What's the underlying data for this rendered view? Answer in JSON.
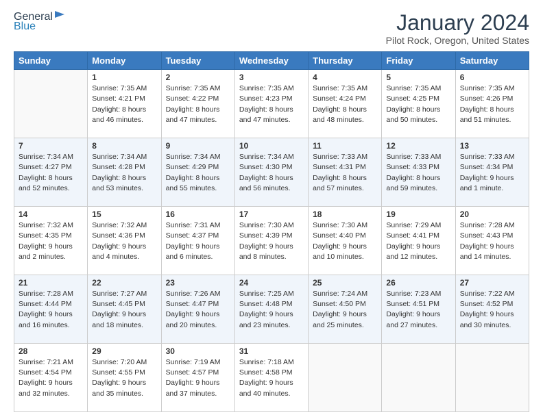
{
  "header": {
    "logo_general": "General",
    "logo_blue": "Blue",
    "main_title": "January 2024",
    "subtitle": "Pilot Rock, Oregon, United States"
  },
  "days_of_week": [
    "Sunday",
    "Monday",
    "Tuesday",
    "Wednesday",
    "Thursday",
    "Friday",
    "Saturday"
  ],
  "weeks": [
    [
      {
        "day": "",
        "sunrise": "",
        "sunset": "",
        "daylight": "",
        "empty": true
      },
      {
        "day": "1",
        "sunrise": "Sunrise: 7:35 AM",
        "sunset": "Sunset: 4:21 PM",
        "daylight": "Daylight: 8 hours and 46 minutes."
      },
      {
        "day": "2",
        "sunrise": "Sunrise: 7:35 AM",
        "sunset": "Sunset: 4:22 PM",
        "daylight": "Daylight: 8 hours and 47 minutes."
      },
      {
        "day": "3",
        "sunrise": "Sunrise: 7:35 AM",
        "sunset": "Sunset: 4:23 PM",
        "daylight": "Daylight: 8 hours and 47 minutes."
      },
      {
        "day": "4",
        "sunrise": "Sunrise: 7:35 AM",
        "sunset": "Sunset: 4:24 PM",
        "daylight": "Daylight: 8 hours and 48 minutes."
      },
      {
        "day": "5",
        "sunrise": "Sunrise: 7:35 AM",
        "sunset": "Sunset: 4:25 PM",
        "daylight": "Daylight: 8 hours and 50 minutes."
      },
      {
        "day": "6",
        "sunrise": "Sunrise: 7:35 AM",
        "sunset": "Sunset: 4:26 PM",
        "daylight": "Daylight: 8 hours and 51 minutes."
      }
    ],
    [
      {
        "day": "7",
        "sunrise": "Sunrise: 7:34 AM",
        "sunset": "Sunset: 4:27 PM",
        "daylight": "Daylight: 8 hours and 52 minutes."
      },
      {
        "day": "8",
        "sunrise": "Sunrise: 7:34 AM",
        "sunset": "Sunset: 4:28 PM",
        "daylight": "Daylight: 8 hours and 53 minutes."
      },
      {
        "day": "9",
        "sunrise": "Sunrise: 7:34 AM",
        "sunset": "Sunset: 4:29 PM",
        "daylight": "Daylight: 8 hours and 55 minutes."
      },
      {
        "day": "10",
        "sunrise": "Sunrise: 7:34 AM",
        "sunset": "Sunset: 4:30 PM",
        "daylight": "Daylight: 8 hours and 56 minutes."
      },
      {
        "day": "11",
        "sunrise": "Sunrise: 7:33 AM",
        "sunset": "Sunset: 4:31 PM",
        "daylight": "Daylight: 8 hours and 57 minutes."
      },
      {
        "day": "12",
        "sunrise": "Sunrise: 7:33 AM",
        "sunset": "Sunset: 4:33 PM",
        "daylight": "Daylight: 8 hours and 59 minutes."
      },
      {
        "day": "13",
        "sunrise": "Sunrise: 7:33 AM",
        "sunset": "Sunset: 4:34 PM",
        "daylight": "Daylight: 9 hours and 1 minute."
      }
    ],
    [
      {
        "day": "14",
        "sunrise": "Sunrise: 7:32 AM",
        "sunset": "Sunset: 4:35 PM",
        "daylight": "Daylight: 9 hours and 2 minutes."
      },
      {
        "day": "15",
        "sunrise": "Sunrise: 7:32 AM",
        "sunset": "Sunset: 4:36 PM",
        "daylight": "Daylight: 9 hours and 4 minutes."
      },
      {
        "day": "16",
        "sunrise": "Sunrise: 7:31 AM",
        "sunset": "Sunset: 4:37 PM",
        "daylight": "Daylight: 9 hours and 6 minutes."
      },
      {
        "day": "17",
        "sunrise": "Sunrise: 7:30 AM",
        "sunset": "Sunset: 4:39 PM",
        "daylight": "Daylight: 9 hours and 8 minutes."
      },
      {
        "day": "18",
        "sunrise": "Sunrise: 7:30 AM",
        "sunset": "Sunset: 4:40 PM",
        "daylight": "Daylight: 9 hours and 10 minutes."
      },
      {
        "day": "19",
        "sunrise": "Sunrise: 7:29 AM",
        "sunset": "Sunset: 4:41 PM",
        "daylight": "Daylight: 9 hours and 12 minutes."
      },
      {
        "day": "20",
        "sunrise": "Sunrise: 7:28 AM",
        "sunset": "Sunset: 4:43 PM",
        "daylight": "Daylight: 9 hours and 14 minutes."
      }
    ],
    [
      {
        "day": "21",
        "sunrise": "Sunrise: 7:28 AM",
        "sunset": "Sunset: 4:44 PM",
        "daylight": "Daylight: 9 hours and 16 minutes."
      },
      {
        "day": "22",
        "sunrise": "Sunrise: 7:27 AM",
        "sunset": "Sunset: 4:45 PM",
        "daylight": "Daylight: 9 hours and 18 minutes."
      },
      {
        "day": "23",
        "sunrise": "Sunrise: 7:26 AM",
        "sunset": "Sunset: 4:47 PM",
        "daylight": "Daylight: 9 hours and 20 minutes."
      },
      {
        "day": "24",
        "sunrise": "Sunrise: 7:25 AM",
        "sunset": "Sunset: 4:48 PM",
        "daylight": "Daylight: 9 hours and 23 minutes."
      },
      {
        "day": "25",
        "sunrise": "Sunrise: 7:24 AM",
        "sunset": "Sunset: 4:50 PM",
        "daylight": "Daylight: 9 hours and 25 minutes."
      },
      {
        "day": "26",
        "sunrise": "Sunrise: 7:23 AM",
        "sunset": "Sunset: 4:51 PM",
        "daylight": "Daylight: 9 hours and 27 minutes."
      },
      {
        "day": "27",
        "sunrise": "Sunrise: 7:22 AM",
        "sunset": "Sunset: 4:52 PM",
        "daylight": "Daylight: 9 hours and 30 minutes."
      }
    ],
    [
      {
        "day": "28",
        "sunrise": "Sunrise: 7:21 AM",
        "sunset": "Sunset: 4:54 PM",
        "daylight": "Daylight: 9 hours and 32 minutes."
      },
      {
        "day": "29",
        "sunrise": "Sunrise: 7:20 AM",
        "sunset": "Sunset: 4:55 PM",
        "daylight": "Daylight: 9 hours and 35 minutes."
      },
      {
        "day": "30",
        "sunrise": "Sunrise: 7:19 AM",
        "sunset": "Sunset: 4:57 PM",
        "daylight": "Daylight: 9 hours and 37 minutes."
      },
      {
        "day": "31",
        "sunrise": "Sunrise: 7:18 AM",
        "sunset": "Sunset: 4:58 PM",
        "daylight": "Daylight: 9 hours and 40 minutes."
      },
      {
        "day": "",
        "sunrise": "",
        "sunset": "",
        "daylight": "",
        "empty": true
      },
      {
        "day": "",
        "sunrise": "",
        "sunset": "",
        "daylight": "",
        "empty": true
      },
      {
        "day": "",
        "sunrise": "",
        "sunset": "",
        "daylight": "",
        "empty": true
      }
    ]
  ]
}
